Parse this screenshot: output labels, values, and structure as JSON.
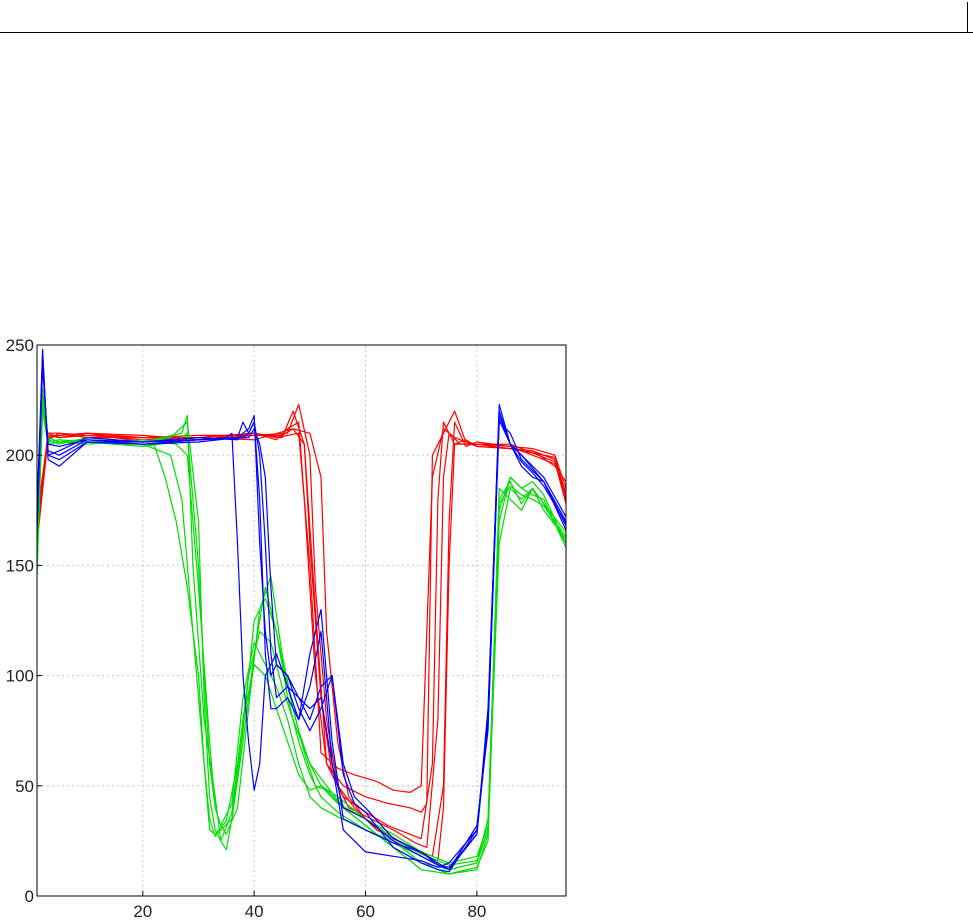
{
  "chart_data": {
    "type": "line",
    "title": "",
    "xlabel": "",
    "ylabel": "",
    "xlim": [
      1,
      96
    ],
    "ylim": [
      0,
      250
    ],
    "xticks": [
      20,
      40,
      60,
      80
    ],
    "yticks": [
      0,
      50,
      100,
      150,
      200,
      250
    ],
    "grid": true,
    "legend": "none",
    "colors": {
      "red": "#ff0000",
      "green": "#00dd00",
      "blue": "#0000ff",
      "grid": "#c8c8c8",
      "axes": "#000000"
    },
    "series": [
      {
        "color": "red",
        "x": [
          1,
          3,
          5,
          10,
          20,
          30,
          40,
          44,
          46,
          48,
          49,
          51,
          53,
          56,
          60,
          64,
          68,
          70,
          72,
          73,
          74,
          76,
          80,
          86,
          90,
          94,
          96
        ],
        "y": [
          160,
          208,
          209,
          210,
          208,
          208,
          210,
          207,
          212,
          215,
          180,
          100,
          60,
          45,
          38,
          32,
          28,
          26,
          60,
          180,
          215,
          205,
          205,
          204,
          203,
          200,
          185
        ]
      },
      {
        "color": "red",
        "x": [
          1,
          3,
          5,
          10,
          20,
          30,
          40,
          45,
          47,
          49,
          50,
          52,
          54,
          57,
          61,
          65,
          69,
          71,
          73,
          74,
          75,
          77,
          80,
          86,
          90,
          94,
          96
        ],
        "y": [
          165,
          210,
          208,
          210,
          209,
          207,
          210,
          208,
          220,
          205,
          160,
          90,
          55,
          40,
          35,
          30,
          24,
          22,
          80,
          190,
          210,
          205,
          205,
          203,
          202,
          198,
          180
        ]
      },
      {
        "color": "red",
        "x": [
          1,
          3,
          5,
          10,
          20,
          30,
          40,
          46,
          48,
          50,
          51,
          53,
          55,
          58,
          62,
          66,
          70,
          72,
          74,
          75,
          76,
          78,
          80,
          86,
          90,
          94,
          96
        ],
        "y": [
          170,
          207,
          210,
          208,
          208,
          209,
          209,
          210,
          223,
          200,
          140,
          80,
          50,
          40,
          30,
          25,
          20,
          18,
          50,
          170,
          215,
          204,
          206,
          204,
          200,
          196,
          183
        ]
      },
      {
        "color": "red",
        "x": [
          1,
          3,
          5,
          10,
          20,
          30,
          40,
          47,
          50,
          52,
          53,
          55,
          57,
          60,
          64,
          68,
          71,
          73,
          74,
          75,
          76,
          78,
          80,
          86,
          90,
          94,
          96
        ],
        "y": [
          172,
          209,
          208,
          209,
          207,
          208,
          207,
          212,
          210,
          190,
          120,
          70,
          45,
          35,
          28,
          22,
          18,
          16,
          40,
          150,
          205,
          207,
          204,
          203,
          202,
          195,
          188
        ]
      },
      {
        "color": "red",
        "x": [
          1,
          3,
          5,
          10,
          20,
          30,
          40,
          44,
          46,
          48,
          50,
          52,
          55,
          58,
          62,
          65,
          68,
          70,
          72,
          74,
          76,
          80,
          86,
          90,
          94,
          96
        ],
        "y": [
          162,
          208,
          209,
          210,
          206,
          208,
          210,
          208,
          209,
          210,
          150,
          65,
          58,
          55,
          52,
          48,
          47,
          50,
          190,
          212,
          208,
          204,
          203,
          201,
          197,
          178
        ]
      },
      {
        "color": "red",
        "x": [
          1,
          3,
          5,
          10,
          20,
          30,
          40,
          45,
          47,
          49,
          51,
          53,
          56,
          60,
          64,
          68,
          70,
          71,
          72,
          74,
          76,
          78,
          80,
          86,
          90,
          94,
          96
        ],
        "y": [
          168,
          210,
          210,
          209,
          208,
          207,
          209,
          209,
          212,
          205,
          130,
          60,
          50,
          45,
          42,
          40,
          38,
          42,
          200,
          210,
          220,
          206,
          205,
          205,
          201,
          199,
          182
        ]
      },
      {
        "color": "green",
        "x": [
          1,
          2,
          3,
          5,
          10,
          20,
          25,
          27,
          29,
          31,
          32,
          33,
          34,
          36,
          38,
          40,
          42,
          44,
          46,
          48,
          50,
          52,
          55,
          60,
          65,
          70,
          75,
          80,
          82,
          84,
          86,
          88,
          90,
          92,
          96
        ],
        "y": [
          150,
          220,
          205,
          206,
          207,
          205,
          200,
          180,
          120,
          60,
          35,
          27,
          30,
          35,
          70,
          110,
          140,
          120,
          90,
          70,
          55,
          45,
          38,
          30,
          25,
          15,
          12,
          15,
          30,
          160,
          185,
          180,
          185,
          178,
          160
        ]
      },
      {
        "color": "green",
        "x": [
          1,
          2,
          3,
          5,
          10,
          20,
          26,
          28,
          30,
          32,
          33,
          34,
          35,
          37,
          39,
          41,
          43,
          45,
          47,
          49,
          51,
          53,
          56,
          60,
          65,
          70,
          75,
          80,
          82,
          84,
          86,
          88,
          90,
          92,
          96
        ],
        "y": [
          145,
          225,
          205,
          206,
          205,
          207,
          205,
          200,
          140,
          70,
          40,
          32,
          28,
          40,
          85,
          130,
          145,
          110,
          85,
          65,
          50,
          48,
          40,
          32,
          22,
          12,
          10,
          13,
          25,
          170,
          190,
          185,
          182,
          180,
          158
        ]
      },
      {
        "color": "green",
        "x": [
          1,
          2,
          3,
          5,
          10,
          20,
          27,
          28,
          29,
          31,
          33,
          34,
          35,
          36,
          38,
          40,
          42,
          44,
          46,
          48,
          50,
          52,
          55,
          60,
          65,
          70,
          75,
          80,
          82,
          84,
          86,
          88,
          90,
          92,
          96
        ],
        "y": [
          160,
          230,
          207,
          205,
          208,
          206,
          210,
          218,
          150,
          80,
          45,
          25,
          21,
          35,
          75,
          125,
          135,
          120,
          95,
          75,
          60,
          50,
          42,
          35,
          28,
          20,
          15,
          18,
          32,
          180,
          188,
          178,
          185,
          175,
          162
        ]
      },
      {
        "color": "green",
        "x": [
          1,
          2,
          3,
          5,
          10,
          20,
          22,
          24,
          26,
          28,
          30,
          31,
          32,
          33,
          35,
          37,
          39,
          41,
          43,
          45,
          47,
          50,
          53,
          56,
          60,
          65,
          70,
          75,
          80,
          82,
          84,
          86,
          88,
          90,
          92,
          96
        ],
        "y": [
          155,
          222,
          206,
          207,
          206,
          205,
          205,
          190,
          170,
          140,
          100,
          60,
          30,
          28,
          34,
          60,
          100,
          120,
          115,
          95,
          80,
          60,
          50,
          40,
          32,
          22,
          15,
          10,
          12,
          28,
          185,
          180,
          175,
          185,
          178,
          165
        ]
      },
      {
        "color": "green",
        "x": [
          1,
          2,
          3,
          5,
          10,
          20,
          26,
          28,
          30,
          31,
          32,
          33,
          34,
          36,
          38,
          40,
          42,
          44,
          46,
          48,
          50,
          52,
          55,
          60,
          65,
          70,
          75,
          80,
          82,
          84,
          86,
          88,
          90,
          92,
          96
        ],
        "y": [
          158,
          228,
          208,
          206,
          206,
          204,
          206,
          210,
          150,
          100,
          60,
          40,
          32,
          42,
          90,
          115,
          105,
          95,
          80,
          60,
          45,
          40,
          36,
          30,
          24,
          18,
          12,
          15,
          35,
          175,
          190,
          185,
          188,
          182,
          160
        ]
      },
      {
        "color": "green",
        "x": [
          1,
          2,
          3,
          5,
          10,
          20,
          25,
          28,
          30,
          31,
          32,
          33,
          34,
          36,
          38,
          40,
          42,
          44,
          46,
          48,
          50,
          52,
          55,
          60,
          65,
          70,
          75,
          80,
          82,
          84,
          86,
          88,
          90,
          92,
          96
        ],
        "y": [
          152,
          224,
          206,
          207,
          206,
          206,
          208,
          215,
          170,
          90,
          45,
          30,
          25,
          38,
          80,
          105,
          100,
          85,
          70,
          55,
          48,
          50,
          45,
          35,
          26,
          19,
          14,
          16,
          30,
          178,
          186,
          182,
          180,
          177,
          163
        ]
      },
      {
        "color": "blue",
        "x": [
          1,
          2,
          3,
          5,
          10,
          20,
          30,
          35,
          36,
          37,
          38,
          39,
          40,
          41,
          42,
          44,
          46,
          48,
          50,
          52,
          54,
          56,
          60,
          65,
          70,
          73,
          75,
          80,
          82,
          84,
          86,
          88,
          90,
          92,
          96
        ],
        "y": [
          170,
          245,
          200,
          202,
          208,
          206,
          207,
          208,
          210,
          160,
          100,
          70,
          48,
          60,
          100,
          110,
          95,
          80,
          95,
          120,
          60,
          30,
          20,
          18,
          16,
          13,
          15,
          30,
          80,
          220,
          205,
          195,
          190,
          188,
          168
        ]
      },
      {
        "color": "blue",
        "x": [
          1,
          2,
          3,
          5,
          10,
          20,
          30,
          37,
          38,
          39,
          40,
          41,
          42,
          43,
          44,
          46,
          48,
          50,
          52,
          54,
          56,
          60,
          65,
          70,
          73,
          75,
          80,
          82,
          84,
          86,
          88,
          90,
          92,
          96
        ],
        "y": [
          175,
          248,
          198,
          195,
          206,
          205,
          206,
          208,
          215,
          210,
          215,
          180,
          110,
          85,
          85,
          90,
          80,
          110,
          130,
          70,
          35,
          30,
          24,
          20,
          15,
          12,
          32,
          75,
          215,
          210,
          198,
          193,
          188,
          170
        ]
      },
      {
        "color": "blue",
        "x": [
          1,
          2,
          3,
          5,
          10,
          20,
          30,
          37,
          38,
          39,
          40,
          41,
          42,
          43,
          44,
          46,
          48,
          50,
          52,
          54,
          56,
          60,
          65,
          70,
          73,
          75,
          80,
          82,
          84,
          86,
          88,
          90,
          92,
          96
        ],
        "y": [
          165,
          240,
          205,
          204,
          207,
          206,
          208,
          207,
          210,
          212,
          218,
          160,
          120,
          100,
          105,
          100,
          90,
          85,
          90,
          60,
          40,
          35,
          25,
          18,
          14,
          13,
          28,
          85,
          218,
          205,
          200,
          195,
          190,
          172
        ]
      },
      {
        "color": "blue",
        "x": [
          1,
          2,
          3,
          5,
          10,
          20,
          30,
          38,
          39,
          40,
          41,
          42,
          43,
          44,
          46,
          48,
          50,
          52,
          54,
          56,
          58,
          60,
          65,
          70,
          73,
          75,
          80,
          82,
          84,
          86,
          88,
          90,
          92,
          96
        ],
        "y": [
          172,
          243,
          202,
          200,
          207,
          205,
          207,
          208,
          210,
          215,
          200,
          160,
          110,
          90,
          95,
          90,
          80,
          95,
          100,
          55,
          42,
          38,
          22,
          15,
          12,
          11,
          30,
          80,
          223,
          205,
          197,
          192,
          186,
          169
        ]
      },
      {
        "color": "blue",
        "x": [
          1,
          2,
          3,
          5,
          10,
          20,
          30,
          39,
          40,
          41,
          42,
          43,
          44,
          46,
          48,
          50,
          52,
          54,
          56,
          58,
          60,
          65,
          70,
          73,
          75,
          80,
          82,
          84,
          86,
          88,
          90,
          92,
          96
        ],
        "y": [
          168,
          246,
          200,
          198,
          206,
          205,
          207,
          208,
          212,
          205,
          190,
          140,
          105,
          100,
          85,
          75,
          85,
          100,
          60,
          45,
          40,
          26,
          20,
          14,
          12,
          28,
          78,
          216,
          205,
          200,
          194,
          188,
          166
        ]
      }
    ]
  }
}
